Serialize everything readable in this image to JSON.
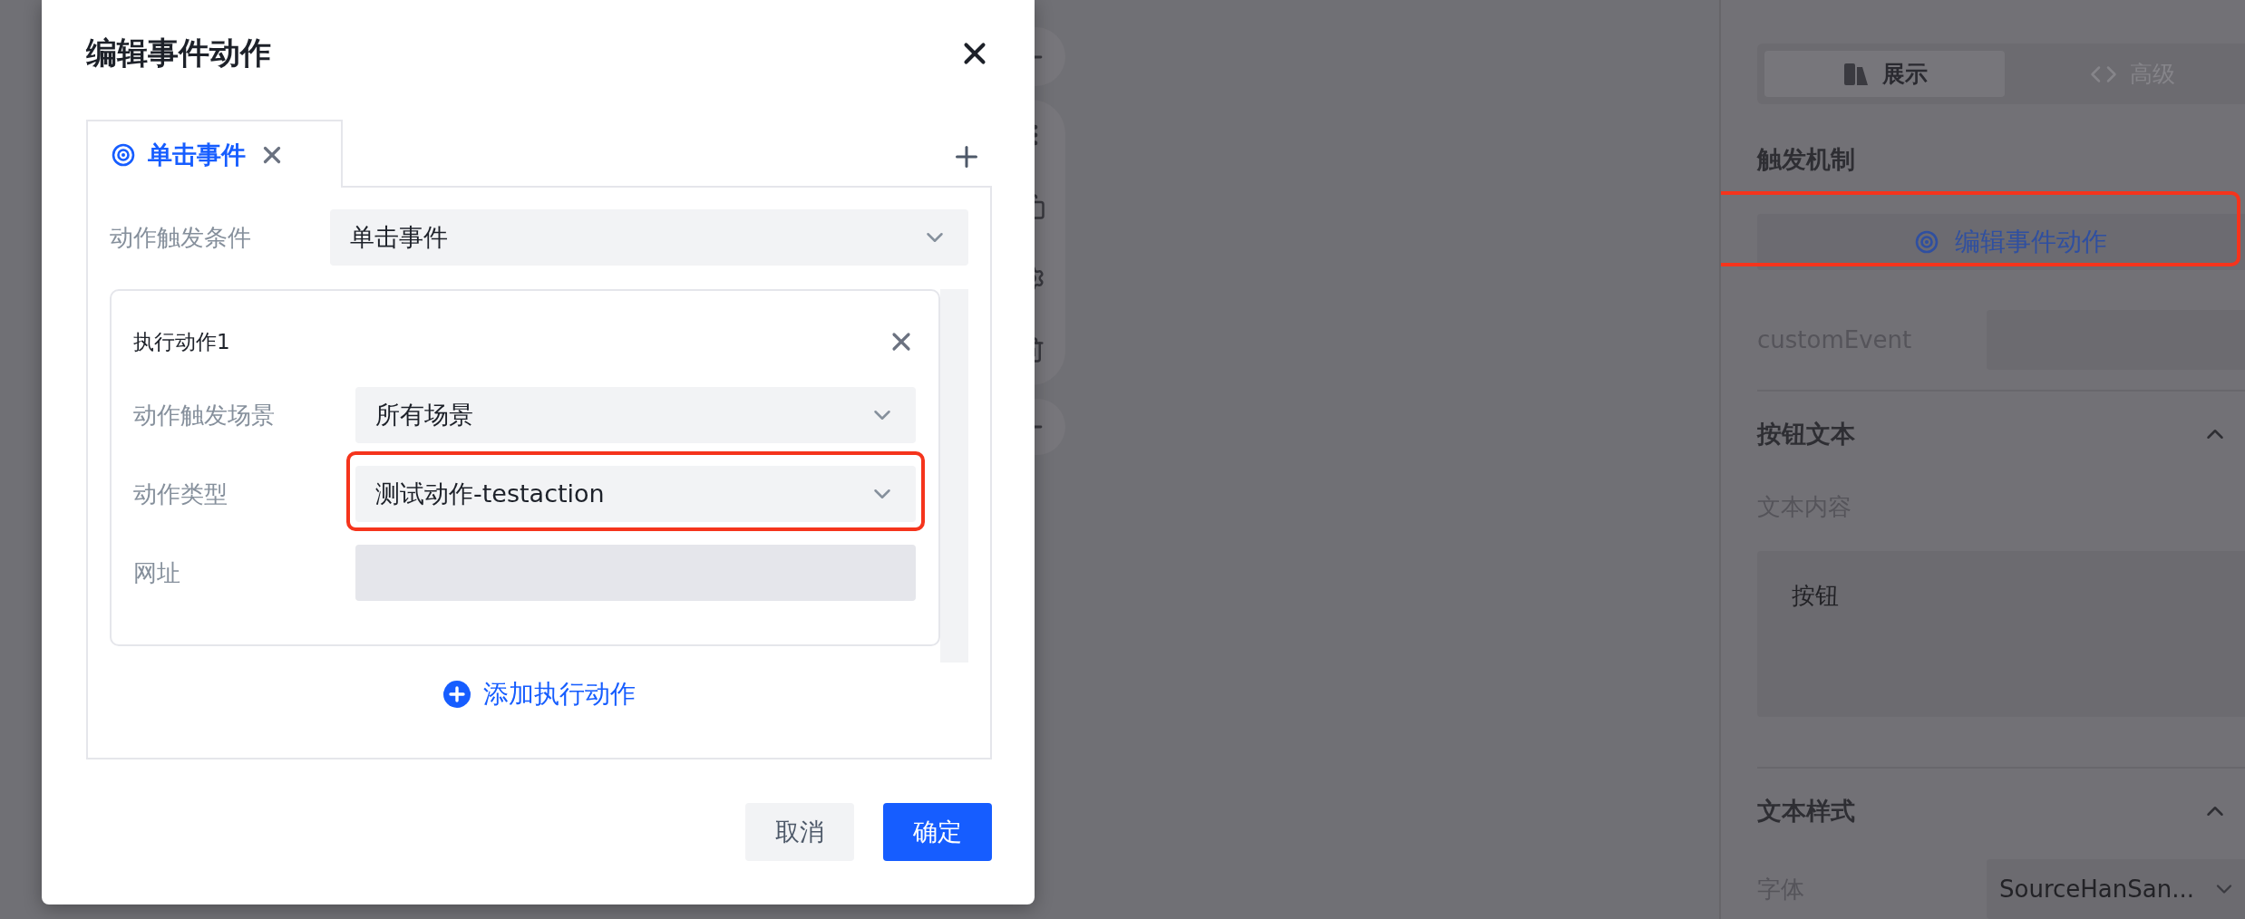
{
  "modal": {
    "title": "编辑事件动作",
    "tabs": [
      {
        "label": "单击事件",
        "selected": true
      }
    ],
    "condition": {
      "label": "动作触发条件",
      "value": "单击事件"
    },
    "actions": [
      {
        "title": "执行动作1",
        "fields": [
          {
            "kind": "select",
            "label": "动作触发场景",
            "value": "所有场景",
            "highlighted": false
          },
          {
            "kind": "select",
            "label": "动作类型",
            "value": "测试动作-testaction",
            "highlighted": true
          },
          {
            "kind": "input",
            "label": "网址",
            "highlighted": false
          }
        ]
      }
    ],
    "add_action": "添加执行动作",
    "buttons": [
      {
        "kind": "secondary",
        "label": "取消"
      },
      {
        "kind": "primary",
        "label": "确定"
      }
    ]
  },
  "side_panel": {
    "tabs": [
      {
        "kind": "display",
        "label": "展示",
        "selected": true
      },
      {
        "kind": "code",
        "label": "高级",
        "selected": false
      }
    ],
    "trigger": {
      "heading": "触发机制",
      "button": "编辑事件动作",
      "highlighted": true
    },
    "custom_event": {
      "label": "customEvent"
    },
    "sections": [
      {
        "heading": "按钮文本",
        "expanded": true,
        "field": {
          "kind": "textarea",
          "label": "文本内容",
          "value": "按钮"
        }
      },
      {
        "heading": "文本样式",
        "expanded": true,
        "field": {
          "kind": "select",
          "label": "字体",
          "value": "SourceHanSan..."
        }
      }
    ]
  }
}
